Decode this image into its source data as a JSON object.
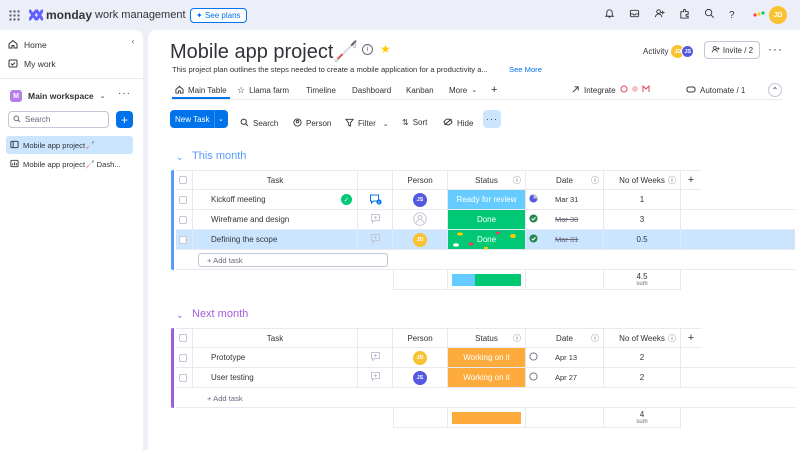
{
  "colors": {
    "accent": "#0073ea",
    "ready": "#66ccff",
    "done": "#00c875",
    "working": "#fdab3d",
    "this_month": "#579bfc",
    "next_month": "#a25ddc",
    "selected_row": "#cce5ff"
  },
  "topbar": {
    "brand": "monday",
    "brand_suffix": "work management",
    "see_plans": "See plans",
    "user_initials": "JD"
  },
  "sidebar": {
    "home": "Home",
    "my_work": "My work",
    "workspace_initial": "M",
    "workspace": "Main workspace",
    "search_placeholder": "Search",
    "boards": [
      "Mobile app project🦯",
      "Mobile app project🦯 Dash..."
    ]
  },
  "board": {
    "title": "Mobile app project🦯",
    "description": "This project plan outlines the steps needed to create a mobile application for a productivity a...",
    "see_more": "See More",
    "activity": "Activity",
    "invite": "Invite / 2",
    "activity_avatars": [
      "JD",
      "JS"
    ]
  },
  "tabs": {
    "main_table": "Main Table",
    "llama": "Llama farm",
    "timeline": "Timeline",
    "dashboard": "Dashboard",
    "kanban": "Kanban",
    "more": "More",
    "integrate": "Integrate",
    "automate": "Automate / 1"
  },
  "toolbar": {
    "new_task": "New Task",
    "search": "Search",
    "person": "Person",
    "filter": "Filter",
    "sort": "Sort",
    "hide": "Hide"
  },
  "columns": {
    "task": "Task",
    "person": "Person",
    "status": "Status",
    "date": "Date",
    "weeks": "No of Weeks"
  },
  "groups": [
    {
      "title": "This month",
      "rows": [
        {
          "task": "Kickoff meeting",
          "person": "JS",
          "status": "Ready for review",
          "date": "Mar 31",
          "weeks": "1",
          "date_done": false
        },
        {
          "task": "Wireframe and design",
          "person": "",
          "status": "Done",
          "date": "Mar 30",
          "weeks": "3",
          "date_done": true
        },
        {
          "task": "Defining the scope",
          "person": "JD",
          "status": "Done",
          "date": "Mar 31",
          "weeks": "0.5",
          "date_done": true
        }
      ],
      "add_task": "+ Add task",
      "sum": "4.5",
      "sum_label": "sum"
    },
    {
      "title": "Next month",
      "rows": [
        {
          "task": "Prototype",
          "person": "JD",
          "status": "Working on it",
          "date": "Apr 13",
          "weeks": "2",
          "date_done": false
        },
        {
          "task": "User testing",
          "person": "JS",
          "status": "Working on it",
          "date": "Apr 27",
          "weeks": "2",
          "date_done": false
        }
      ],
      "add_task": "+ Add task",
      "sum": "4",
      "sum_label": "sum"
    }
  ]
}
